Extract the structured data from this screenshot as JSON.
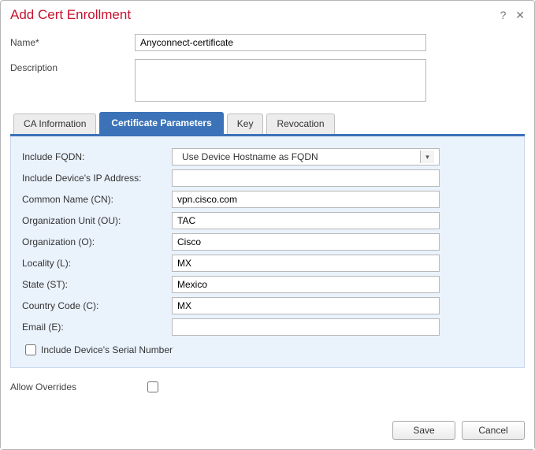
{
  "dialog": {
    "title": "Add Cert Enrollment"
  },
  "form": {
    "name_label": "Name*",
    "name_value": "Anyconnect-certificate",
    "description_label": "Description",
    "description_value": ""
  },
  "tabs": {
    "ca_info": "CA Information",
    "cert_params": "Certificate Parameters",
    "key": "Key",
    "revocation": "Revocation"
  },
  "cert_params": {
    "include_fqdn_label": "Include FQDN:",
    "include_fqdn_value": "Use Device Hostname as FQDN",
    "include_ip_label": "Include Device's IP Address:",
    "include_ip_value": "",
    "cn_label": "Common Name (CN):",
    "cn_value": "vpn.cisco.com",
    "ou_label": "Organization Unit (OU):",
    "ou_value": "TAC",
    "o_label": "Organization (O):",
    "o_value": "Cisco",
    "l_label": "Locality (L):",
    "l_value": "MX",
    "st_label": "State (ST):",
    "st_value": "Mexico",
    "c_label": "Country Code (C):",
    "c_value": "MX",
    "e_label": "Email (E):",
    "e_value": "",
    "include_serial_label": "Include Device's Serial Number"
  },
  "allow_overrides_label": "Allow Overrides",
  "buttons": {
    "save": "Save",
    "cancel": "Cancel"
  }
}
